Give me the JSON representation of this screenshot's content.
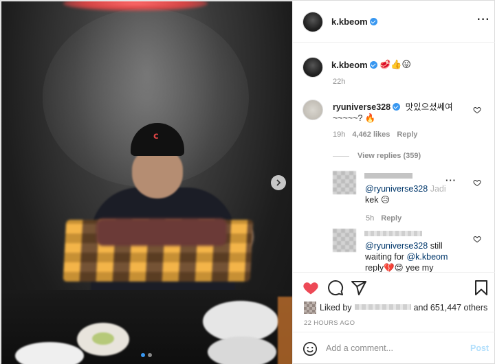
{
  "post": {
    "author": "k.kbeom",
    "more_icon": "more-horizontal-icon"
  },
  "caption": {
    "username": "k.kbeom",
    "emojis": "🥩👍😛",
    "time": "22h"
  },
  "comments": [
    {
      "username": "ryuniverse328",
      "text_line1": "맛있으셨쎄여",
      "text_line2": "~~~~~? 🔥",
      "time": "19h",
      "likes": "4,462 likes",
      "reply": "Reply",
      "view_replies": "View replies (359)"
    }
  ],
  "replies": [
    {
      "mention": "@ryuniverse328",
      "text_faded": "Jadi",
      "text_line2": "kek 😥",
      "time": "5h",
      "reply": "Reply"
    },
    {
      "mention": "@ryuniverse328",
      "text": "still",
      "text_line2_prefix": "waiting for",
      "mention2": "@k.kbeom",
      "text_line3": "reply💔😍 yee my"
    }
  ],
  "likes_row": {
    "prefix": "Liked by",
    "suffix": "and 651,447 others"
  },
  "timestamp": "22 HOURS AGO",
  "add_comment": {
    "placeholder": "Add a comment...",
    "post_label": "Post"
  },
  "carousel": {
    "total": 2,
    "active_index": 0
  },
  "colors": {
    "heart_liked": "#ed4956",
    "verified": "#3897f0",
    "post_disabled": "#b2dffc"
  }
}
